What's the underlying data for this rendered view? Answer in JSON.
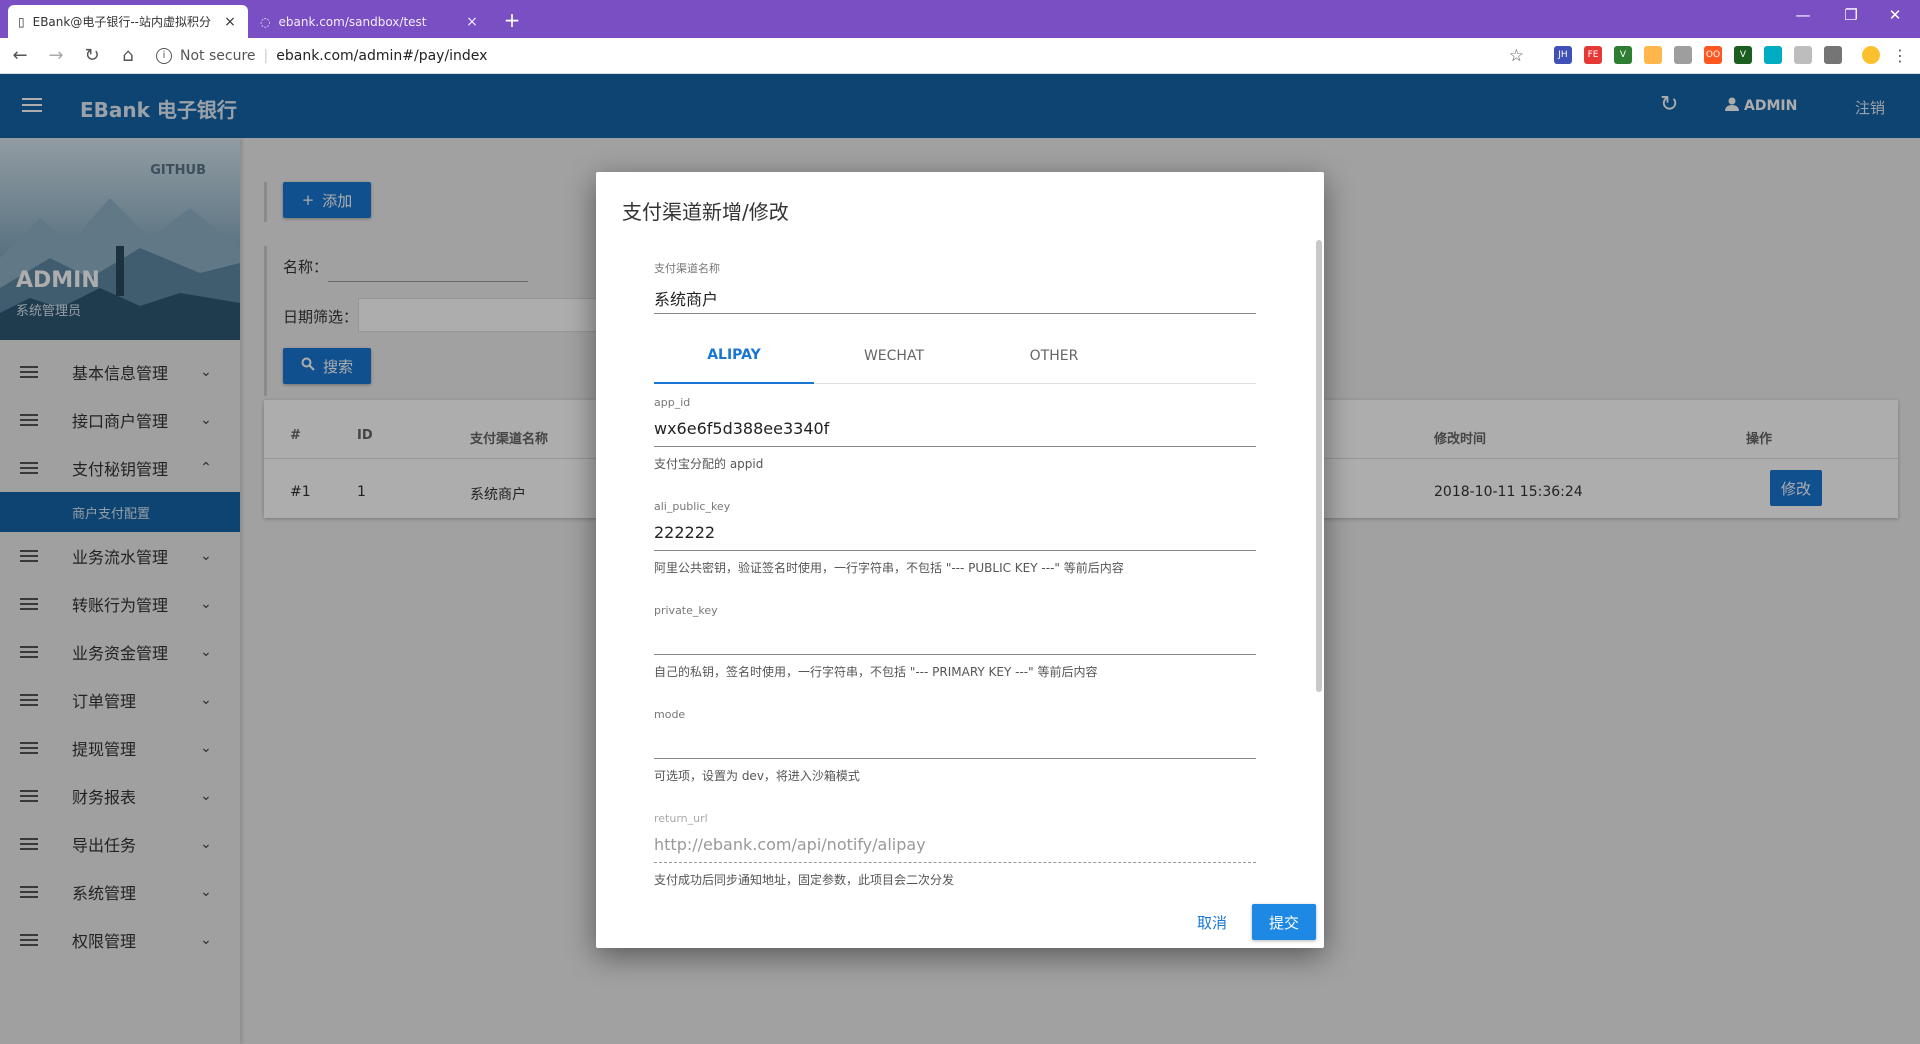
{
  "browser": {
    "tabs": [
      {
        "title": "EBank@电子银行--站内虚拟积分",
        "close": "×"
      },
      {
        "title": "ebank.com/sandbox/test",
        "close": "×"
      }
    ],
    "new_tab": "+",
    "window_controls": {
      "minimize": "—",
      "restore": "❐",
      "close": "✕"
    },
    "nav": {
      "back": "←",
      "forward": "→",
      "reload": "↻",
      "home": "⌂"
    },
    "security_label": "Not secure",
    "url": "ebank.com/admin#/pay/index",
    "star": "☆",
    "extensions": [
      {
        "name": "JH",
        "color": "#3f51b5"
      },
      {
        "name": "FE",
        "color": "#e53935"
      },
      {
        "name": "V",
        "color": "#2e7d32"
      },
      {
        "name": "🍪",
        "color": "#ffffff"
      },
      {
        "name": "▤",
        "color": "#9e9e9e"
      },
      {
        "name": "OO",
        "color": "#ff5722"
      },
      {
        "name": "V",
        "color": "#1b5e20"
      },
      {
        "name": "◲",
        "color": "#00acc1"
      },
      {
        "name": "⋮⋮",
        "color": "#bdbdbd"
      },
      {
        "name": "▭",
        "color": "#757575"
      },
      {
        "name": "☺",
        "color": "#fbc02d"
      },
      {
        "name": "⋮",
        "color": "#ffffff"
      }
    ]
  },
  "header": {
    "menu_icon": "hamburger-icon",
    "brand": "EBank 电子银行",
    "refresh": "↻",
    "user": "ADMIN",
    "logout": "注销"
  },
  "sidebar": {
    "github": "GITHUB",
    "admin_name": "ADMIN",
    "admin_role": "系统管理员",
    "items": [
      {
        "label": "基本信息管理",
        "chevron": "⌄"
      },
      {
        "label": "接口商户管理",
        "chevron": "⌄"
      },
      {
        "label": "支付秘钥管理",
        "chevron": "⌃"
      },
      {
        "label": "业务流水管理",
        "chevron": "⌄"
      },
      {
        "label": "转账行为管理",
        "chevron": "⌄"
      },
      {
        "label": "业务资金管理",
        "chevron": "⌄"
      },
      {
        "label": "订单管理",
        "chevron": "⌄"
      },
      {
        "label": "提现管理",
        "chevron": "⌄"
      },
      {
        "label": "财务报表",
        "chevron": "⌄"
      },
      {
        "label": "导出任务",
        "chevron": "⌄"
      },
      {
        "label": "系统管理",
        "chevron": "⌄"
      },
      {
        "label": "权限管理",
        "chevron": "⌄"
      }
    ],
    "active_sub": "商户支付配置"
  },
  "main": {
    "add_button": "添加",
    "add_icon": "+",
    "filter_name_label": "名称：",
    "filter_date_label": "日期筛选：",
    "search_button": "搜索",
    "search_icon": "🔍",
    "table": {
      "headers": [
        "#",
        "ID",
        "支付渠道名称",
        "修改时间",
        "操作"
      ],
      "rows": [
        {
          "index": "#1",
          "id": "1",
          "name": "系统商户",
          "modified": "2018-10-11 15:36:24",
          "action": "修改"
        }
      ]
    }
  },
  "dialog": {
    "title": "支付渠道新增/修改",
    "channel_name_label": "支付渠道名称",
    "channel_name_value": "系统商户",
    "tabs": [
      "ALIPAY",
      "WECHAT",
      "OTHER"
    ],
    "active_tab": "ALIPAY",
    "fields": [
      {
        "label": "app_id",
        "value": "wx6e6f5d388ee3340f",
        "hint": "支付宝分配的 appid"
      },
      {
        "label": "ali_public_key",
        "value": "222222",
        "hint": "阿里公共密钥，验证签名时使用，一行字符串，不包括 \"--- PUBLIC KEY ---\" 等前后内容"
      },
      {
        "label": "private_key",
        "value": "",
        "hint": "自己的私钥，签名时使用，一行字符串，不包括 \"--- PRIMARY KEY ---\" 等前后内容"
      },
      {
        "label": "mode",
        "value": "",
        "hint": "可选项，设置为 dev，将进入沙箱模式"
      },
      {
        "label": "return_url",
        "value": "http://ebank.com/api/notify/alipay",
        "hint": "支付成功后同步通知地址，固定参数，此项目会二次分发"
      }
    ],
    "cancel": "取消",
    "submit": "提交"
  }
}
